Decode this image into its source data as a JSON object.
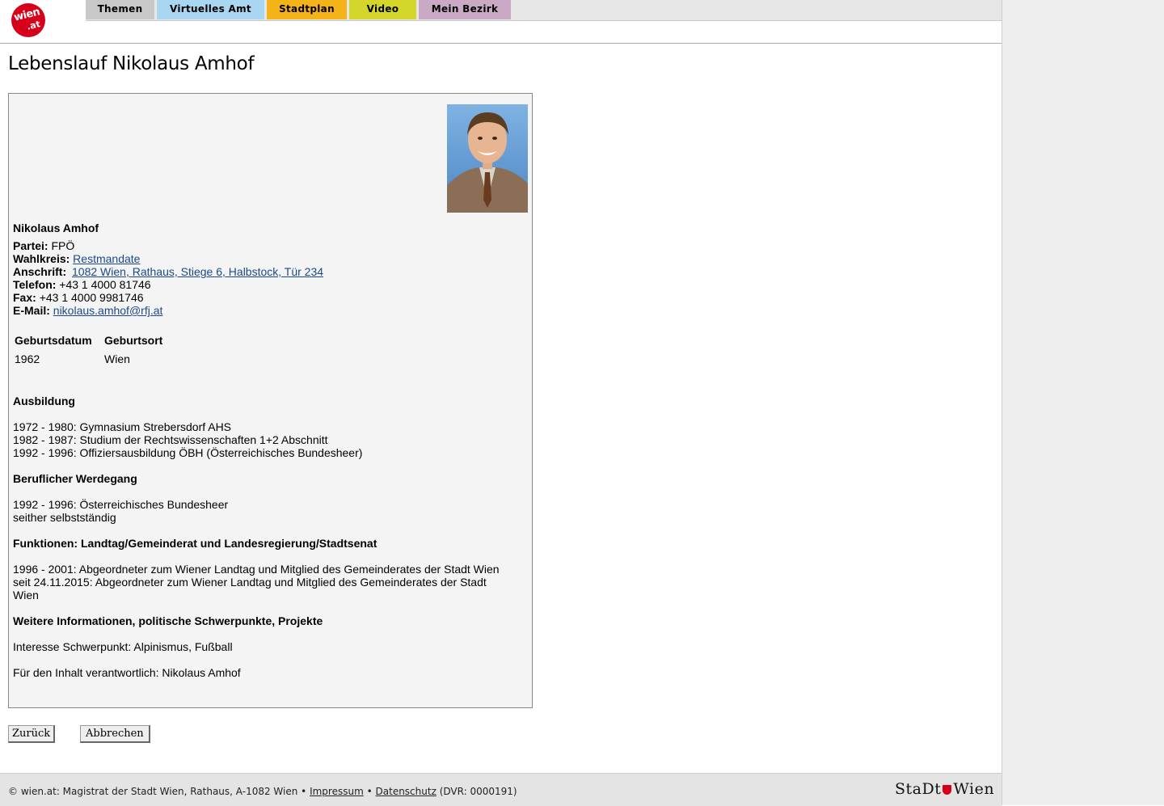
{
  "header": {
    "logo_text_1": "wien",
    "logo_text_2": ".at",
    "nav_tabs": [
      {
        "label": "Themen",
        "color": "#c8c8c8"
      },
      {
        "label": "Virtuelles Amt",
        "color": "#a9d6f0"
      },
      {
        "label": "Stadtplan",
        "color": "#f5b31a"
      },
      {
        "label": "Video",
        "color": "#d4d62a"
      },
      {
        "label": "Mein Bezirk",
        "color": "#c9a9c4"
      }
    ]
  },
  "page_title": "Lebenslauf Nikolaus Amhof",
  "profile": {
    "name": "Nikolaus Amhof",
    "partei_label": "Partei:",
    "partei": "FPÖ",
    "wahlkreis_label": "Wahlkreis:",
    "wahlkreis": "Restmandate",
    "anschrift_label": "Anschrift:",
    "anschrift": "1082 Wien, Rathaus, Stiege 6, Halbstock, Tür 234",
    "telefon_label": "Telefon:",
    "telefon": "+43 1 4000 81746",
    "fax_label": "Fax:",
    "fax": "+43 1 4000 9981746",
    "email_label": "E-Mail:",
    "email": "nikolaus.amhof@rfj.at"
  },
  "birth_table": {
    "headers": [
      "Geburtsdatum",
      "Geburtsort"
    ],
    "row": [
      "1962",
      "Wien"
    ]
  },
  "sections": {
    "ausbildung_title": "Ausbildung",
    "ausbildung": [
      "1972 - 1980: Gymnasium Strebersdorf AHS",
      "1982 - 1987: Studium der Rechtswissenschaften 1+2 Abschnitt",
      "1992 - 1996: Offiziersausbildung ÖBH (Österreichisches Bundesheer)"
    ],
    "beruf_title": "Beruflicher Werdegang",
    "beruf": [
      "1992 - 1996: Österreichisches Bundesheer",
      "seither selbstständig"
    ],
    "funktionen_title": "Funktionen: Landtag/Gemeinderat und Landesregierung/Stadtsenat",
    "funktionen": [
      "1996 - 2001: Abgeordneter zum Wiener Landtag und Mitglied des Gemeinderates der Stadt Wien",
      "seit 24.11.2015: Abgeordneter zum Wiener Landtag und Mitglied des Gemeinderates der Stadt",
      "Wien"
    ],
    "weitere_title": "Weitere Informationen, politische Schwerpunkte, Projekte",
    "weitere": "Interesse Schwerpunkt: Alpinismus, Fußball",
    "verantwortlich": "Für den Inhalt verantwortlich: Nikolaus Amhof"
  },
  "buttons": {
    "zurueck": "Zurück",
    "abbrechen": "Abbrechen"
  },
  "footer": {
    "text": "© wien.at: Magistrat der Stadt Wien, Rathaus, A-1082 Wien •",
    "impressum": "Impressum",
    "sep": "•",
    "datenschutz": "Datenschutz",
    "dvr": "(DVR: 0000191)",
    "logo_left": "StaDt",
    "logo_right": "Wien"
  }
}
